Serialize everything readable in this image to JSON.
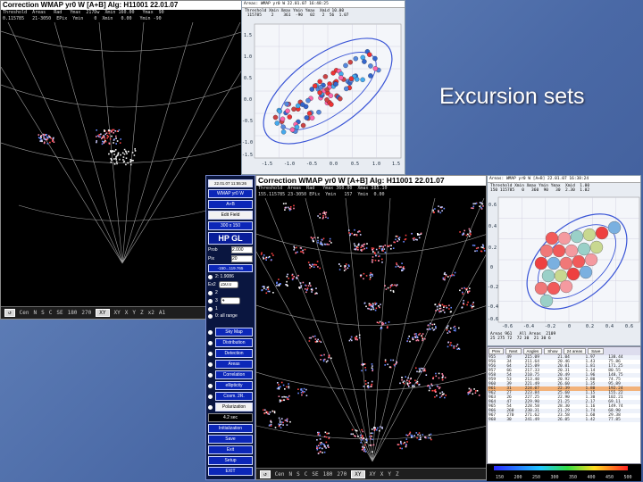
{
  "slide": {
    "title": "Excursion sets"
  },
  "map_window_1": {
    "header": "Correction  WMAP yr0 W  [A+B]  Alg: H11001  22.01.07",
    "stats": "Threshold  Areas   Rad   Ymax  217Dw  Xmin 160.00   Ymax  90\n0.115785   21-3050  EPix  Ymin    0  Xmin   0.00   Ymin -90",
    "statusbar": [
      "Cen",
      "N",
      "S",
      "C",
      "SE",
      "180",
      "270",
      "XY",
      "XY",
      "X",
      "Y",
      "Z",
      "x2",
      "A1"
    ]
  },
  "plot_window_1": {
    "header": "Areas: WMAP yr0 W  22.01.07  16:48:25",
    "stats": "Threshold Xmin Xmax Ymin Ymax  Xmid 10.00\n 115785    2    361  -90   02   2  56  1.07",
    "yticks": [
      "1.5",
      "1.0",
      "0.5",
      "0.0",
      "-0.5",
      "-1.0",
      "-1.5"
    ],
    "xticks": [
      "-1.5",
      "-1.0",
      "-0.5",
      "0.0",
      "0.5",
      "1.0",
      "1.5"
    ]
  },
  "control_panel": {
    "datetime": "22.01.07   11:55:26",
    "source": "WMAP yr0 W",
    "band": "A+B",
    "edit_field": "Edit Field",
    "resolution": "300 x 150",
    "hp_gl": "HP GL",
    "prob_label": "Prob",
    "prob_value": "2.000",
    "pix_label": "Pix",
    "pix_value": "20",
    "range": "-150...119.765",
    "options": [
      {
        "label": "2: 1.9086",
        "value": ""
      },
      {
        "label": "Ex2",
        "value": "150.0"
      },
      {
        "label": "2",
        "value": ""
      },
      {
        "label": "3",
        "value": "4"
      },
      {
        "label": "1",
        "value": "2230"
      },
      {
        "label": "0: all range",
        "value": ""
      }
    ],
    "menu": [
      "Sky Map",
      "Distribution",
      "Detection",
      "Areas",
      "Correlation",
      "ellipticity",
      "Cosm. 2R.",
      "Polarization"
    ],
    "time": "4.2 sec",
    "bottom": [
      "Initialization",
      "Save",
      "Exit",
      "Setup",
      "EXIT"
    ]
  },
  "map_window_2": {
    "header": "Correction  WMAP yr0 W  [A+B]  Alg: H11001  22.01.07",
    "stats": "Threshold  Areas  Rad   Ymax 360.00  Xmax 385.10\n155.115785 23-3050 EPix  Ymin   157  Ymin  0.00",
    "statusbar": [
      "Cen",
      "N",
      "S",
      "C",
      "SE",
      "180",
      "270",
      "XY",
      "XY",
      "X",
      "Y",
      "Z"
    ]
  },
  "plot_window_2": {
    "header": "Areas: WMAP yr0 W  [A+B]  22.01.07  16:38:24",
    "stats": "Threshold Xmin Xmax Ymin Ymax  Xmid  1.00\n150 115785   0   360  90   30  2.30  1.02",
    "yticks": [
      "0.6",
      "0.4",
      "0.2",
      "0",
      "-0.2",
      "-0.4",
      "-0.6"
    ],
    "xticks": [
      "-0.6",
      "-0.4",
      "-0.2",
      "0",
      "0.2",
      "0.4",
      "0.6"
    ],
    "footer": "Areas 961   All Areas  2109\n25 275 72  72 30  21 30 6",
    "buttons": [
      "Prev",
      "Next",
      "Angles",
      "Show",
      "24 areas",
      "Save"
    ]
  },
  "data_table": {
    "rows": [
      [
        "955",
        "49",
        "215.09",
        "21.04",
        "1.97",
        "138.44"
      ],
      [
        "956",
        "34",
        "211.64",
        "20.46",
        "1.43",
        "75.86"
      ],
      [
        "956",
        "64",
        "215.09",
        "20.01",
        "1.81",
        "171.25"
      ],
      [
        "957",
        "66",
        "217.33",
        "20.31",
        "1.14",
        "80.55"
      ],
      [
        "958",
        "54",
        "210.75",
        "20.49",
        "1.96",
        "148.75"
      ],
      [
        "959",
        "53",
        "213.40",
        "20.92",
        "2.80",
        "74.75"
      ],
      [
        "960",
        "39",
        "221.49",
        "26.60",
        "1.35",
        "95.89"
      ],
      [
        "961",
        "31",
        "224.07",
        "22.39",
        "1.80",
        "192.24"
      ],
      [
        "962",
        "27",
        "223.84",
        "25.60",
        "1.15",
        "155.22"
      ],
      [
        "963",
        "26",
        "227.25",
        "22.90",
        "1.30",
        "102.21"
      ],
      [
        "964",
        "47",
        "229.90",
        "21.25",
        "2.17",
        "69.11"
      ],
      [
        "965",
        "54",
        "228.58",
        "28.30",
        "1.16",
        "149.74"
      ],
      [
        "966",
        "260",
        "230.31",
        "21.29",
        "1.74",
        "68.90"
      ],
      [
        "967",
        "270",
        "271.62",
        "23.58",
        "1.60",
        "29.38"
      ],
      [
        "968",
        "30",
        "241.49",
        "26.05",
        "1.42",
        "77.85"
      ]
    ],
    "selected_row": 7
  },
  "colorbar_ticks": [
    "150",
    "200",
    "250",
    "300",
    "350",
    "400",
    "450",
    "500"
  ],
  "colors": {
    "background": "#4a69a6",
    "panel_blue": "#0c27b8",
    "highlight": "#f2b27a"
  }
}
